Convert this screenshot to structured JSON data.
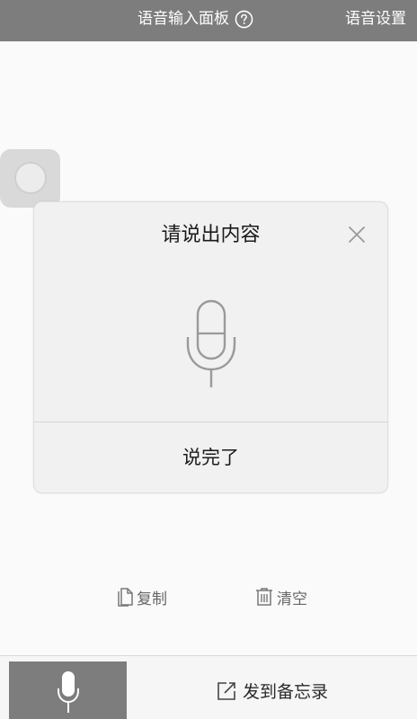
{
  "header": {
    "title": "语音输入面板",
    "settings_label": "语音设置"
  },
  "dialog": {
    "title": "请说出内容",
    "done_label": "说完了"
  },
  "actions": {
    "copy_label": "复制",
    "clear_label": "清空"
  },
  "bottom": {
    "memo_label": "发到备忘录"
  },
  "colors": {
    "bar": "#7d7d7d",
    "dialog_bg": "#f1f1f1",
    "icon_gray": "#8a8a8a"
  },
  "icons": [
    "help-icon",
    "close-icon",
    "microphone-icon",
    "copy-icon",
    "trash-icon",
    "share-icon"
  ]
}
